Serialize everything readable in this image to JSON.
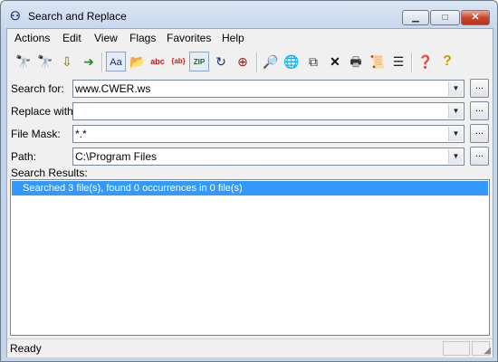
{
  "window": {
    "title": "Search and Replace"
  },
  "menu": {
    "items": [
      "Actions",
      "Edit",
      "View",
      "Flags",
      "Favorites",
      "Help"
    ]
  },
  "toolbar": {
    "icons": [
      {
        "name": "find-icon",
        "glyph": "🔭"
      },
      {
        "name": "find-replace-icon",
        "glyph": "🔭"
      },
      {
        "name": "copy-down-icon",
        "glyph": "⇩"
      },
      {
        "name": "move-right-icon",
        "glyph": "➜"
      },
      {
        "name": "case-sensitive-icon",
        "glyph": "Aa"
      },
      {
        "name": "folder-search-icon",
        "glyph": "📂"
      },
      {
        "name": "whole-word-icon",
        "glyph": "abc"
      },
      {
        "name": "regex-icon",
        "glyph": "{ab}"
      },
      {
        "name": "zip-search-icon",
        "glyph": "ZIP"
      },
      {
        "name": "subfolders-icon",
        "glyph": "↻"
      },
      {
        "name": "backup-icon",
        "glyph": "⊕"
      },
      {
        "name": "lookup-icon",
        "glyph": "🔎"
      },
      {
        "name": "web-icon",
        "glyph": "🌐"
      },
      {
        "name": "copy-icon",
        "glyph": "⧉"
      },
      {
        "name": "delete-icon",
        "glyph": "✕"
      },
      {
        "name": "print-icon",
        "glyph": "🖶"
      },
      {
        "name": "script-icon",
        "glyph": "📜"
      },
      {
        "name": "list-icon",
        "glyph": "☰"
      },
      {
        "name": "context-help-icon",
        "glyph": "❓"
      },
      {
        "name": "help-icon",
        "glyph": "?"
      }
    ]
  },
  "form": {
    "search_label": "Search for:",
    "search_value": "www.CWER.ws",
    "replace_label": "Replace with:",
    "replace_value": "",
    "mask_label": "File Mask:",
    "mask_value": "*.*",
    "path_label": "Path:",
    "path_value": "C:\\Program Files",
    "browse_label": "..."
  },
  "results": {
    "label": "Search Results:",
    "rows": [
      "Searched 3 file(s), found 0 occurrences in 0 file(s)"
    ]
  },
  "status": {
    "text": "Ready"
  }
}
